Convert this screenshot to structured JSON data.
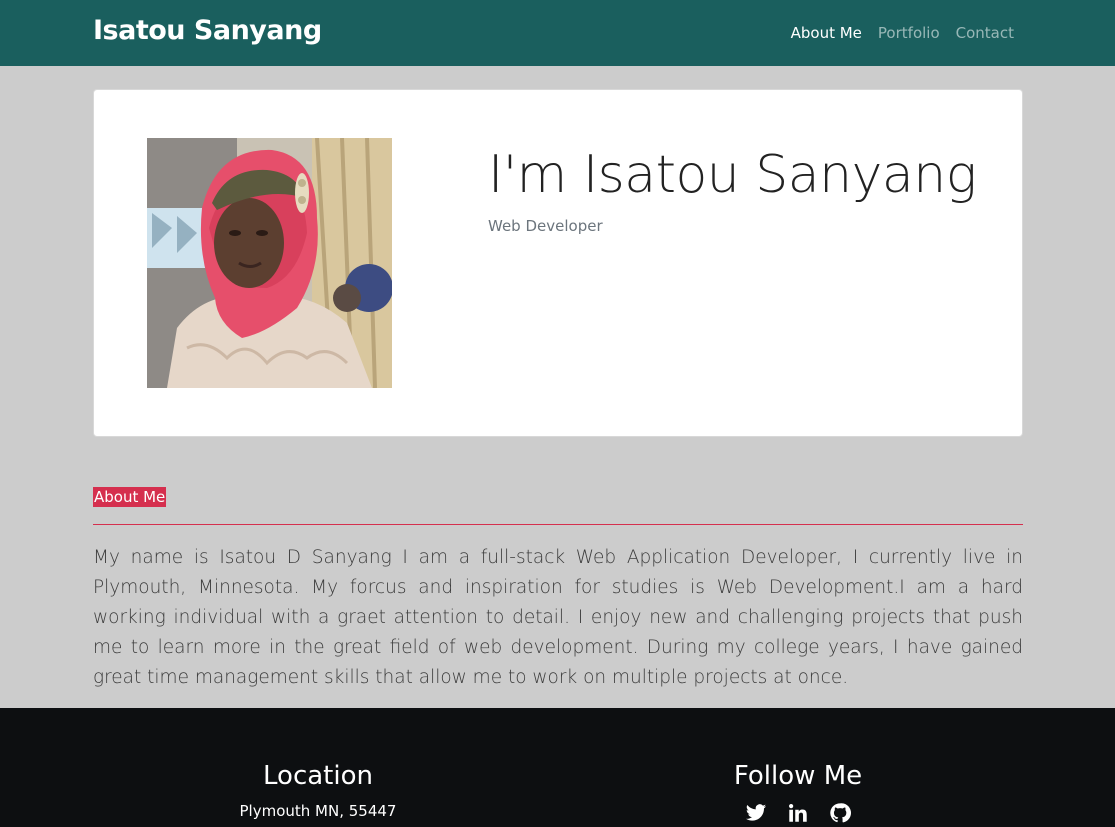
{
  "navbar": {
    "brand": "Isatou Sanyang",
    "links": [
      {
        "label": "About Me",
        "active": true
      },
      {
        "label": "Portfolio",
        "active": false
      },
      {
        "label": "Contact",
        "active": false
      }
    ],
    "background": "#1a5f5e"
  },
  "hero": {
    "title": "I'm Isatou Sanyang",
    "subtitle": "Web Developer",
    "photo_icon": "profile-photo"
  },
  "about": {
    "label": "About Me",
    "text": "My name is Isatou D Sanyang I am a full-stack Web Application Developer, I currently live in Plymouth, Minnesota. My forcus and inspiration for studies is Web Development.I am a hard working individual with a graet attention to detail. I enjoy new and challenging projects that push me to learn more in the great field of web development. During my college years, I have gained great time management skills that allow me to work on multiple projects at once.",
    "accent": "#d52f4e"
  },
  "footer": {
    "location_heading": "Location",
    "address": "Plymouth MN, 55447",
    "follow_heading": "Follow Me",
    "social": [
      "twitter-icon",
      "linkedin-icon",
      "github-icon"
    ],
    "background": "#0d0f11"
  }
}
